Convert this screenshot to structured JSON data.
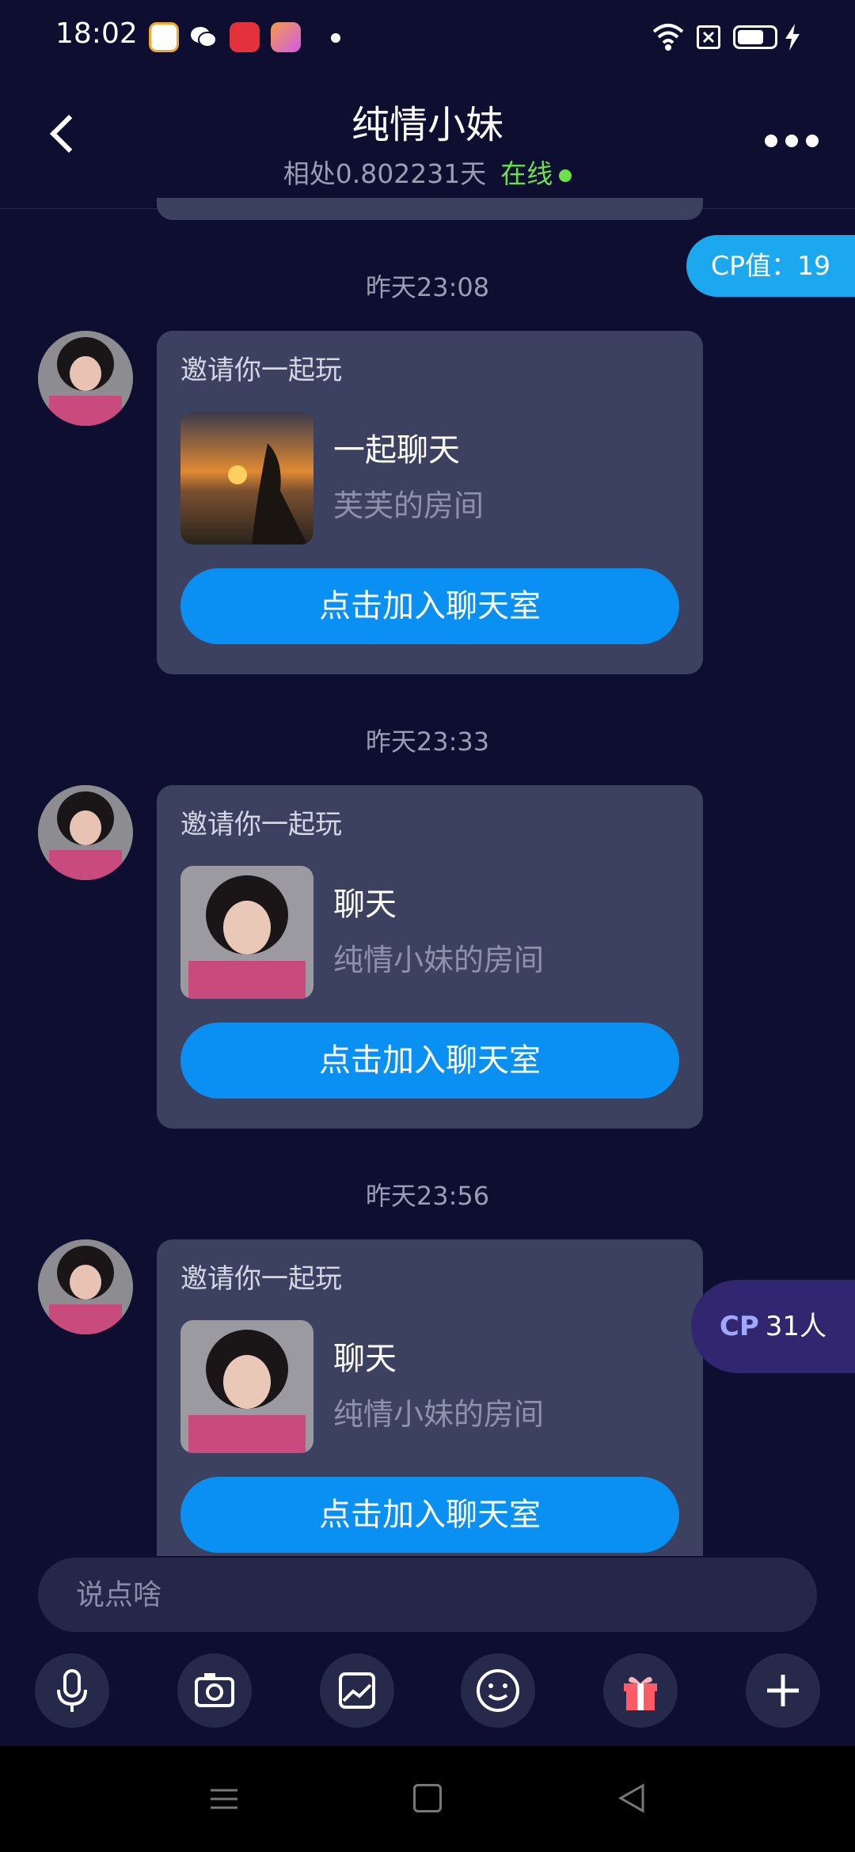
{
  "status": {
    "time": "18:02"
  },
  "header": {
    "title": "纯情小妹",
    "days": "相处0.802231天",
    "online": "在线"
  },
  "cp_value": "CP值：19",
  "messages": [
    {
      "timestamp": "昨天23:08",
      "invite": "邀请你一起玩",
      "room_title": "一起聊天",
      "room_sub": "芙芙的房间",
      "button": "点击加入聊天室"
    },
    {
      "timestamp": "昨天23:33",
      "invite": "邀请你一起玩",
      "room_title": "聊天",
      "room_sub": "纯情小妹的房间",
      "button": "点击加入聊天室"
    },
    {
      "timestamp": "昨天23:56",
      "invite": "邀请你一起玩",
      "room_title": "聊天",
      "room_sub": "纯情小妹的房间",
      "button": "点击加入聊天室"
    }
  ],
  "cp_float": {
    "tag": "CP",
    "count": "31人"
  },
  "input": {
    "placeholder": "说点啥"
  },
  "toolbar": {
    "icons": [
      "mic-icon",
      "camera-icon",
      "image-icon",
      "emoji-icon",
      "gift-icon",
      "plus-icon"
    ]
  },
  "colors": {
    "background": "#0d0e30",
    "card": "#3d4160",
    "accent": "#0a8ff3",
    "online": "#6be04a",
    "cp": "#1ba8ef"
  }
}
